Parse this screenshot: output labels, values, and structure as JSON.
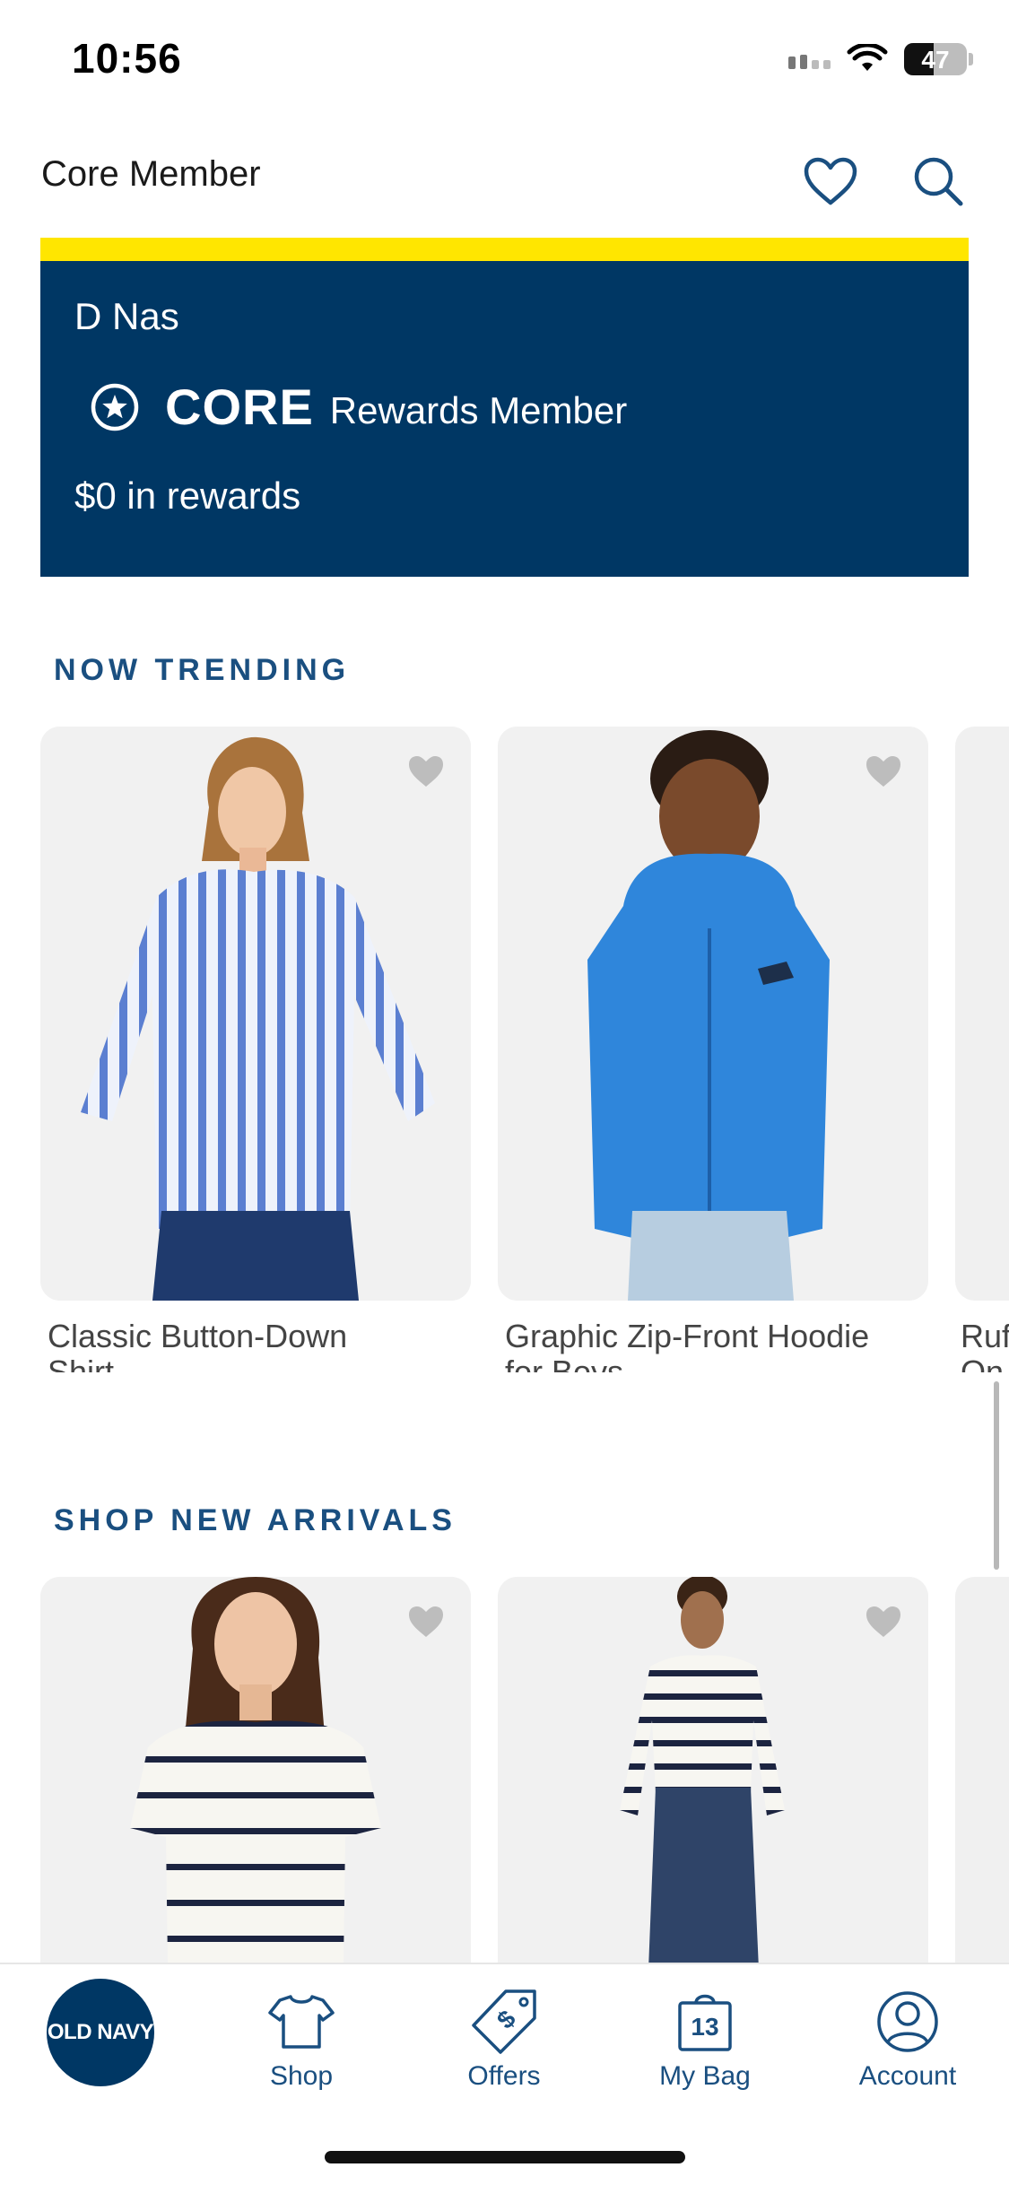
{
  "status_bar": {
    "time": "10:56",
    "battery": "47",
    "battery_level": 0.47
  },
  "header": {
    "title": "Core Member",
    "icons": [
      "heart-icon",
      "search-icon"
    ]
  },
  "rewards": {
    "member_name": "D Nas",
    "tier": "CORE",
    "tier_label": "Rewards Member",
    "amount": "$0 in rewards",
    "colors": {
      "stripe": "#ffe600",
      "card": "#003764"
    }
  },
  "trending": {
    "title": "NOW TRENDING",
    "products": [
      {
        "name": "Classic Button-Down Shirt"
      },
      {
        "name": "Graphic Zip-Front Hoodie for Boys"
      },
      {
        "name": "Ruf\nOn"
      }
    ]
  },
  "new_arrivals": {
    "title": "SHOP NEW ARRIVALS"
  },
  "tabbar": {
    "logo": "OLD NAVY",
    "tabs": [
      {
        "label": "Shop",
        "icon": "shirt-icon"
      },
      {
        "label": "Offers",
        "icon": "tag-icon"
      },
      {
        "label": "My Bag",
        "icon": "bag-icon",
        "badge": "13"
      },
      {
        "label": "Account",
        "icon": "person-icon"
      }
    ]
  },
  "accent_color": "#1a4f80"
}
